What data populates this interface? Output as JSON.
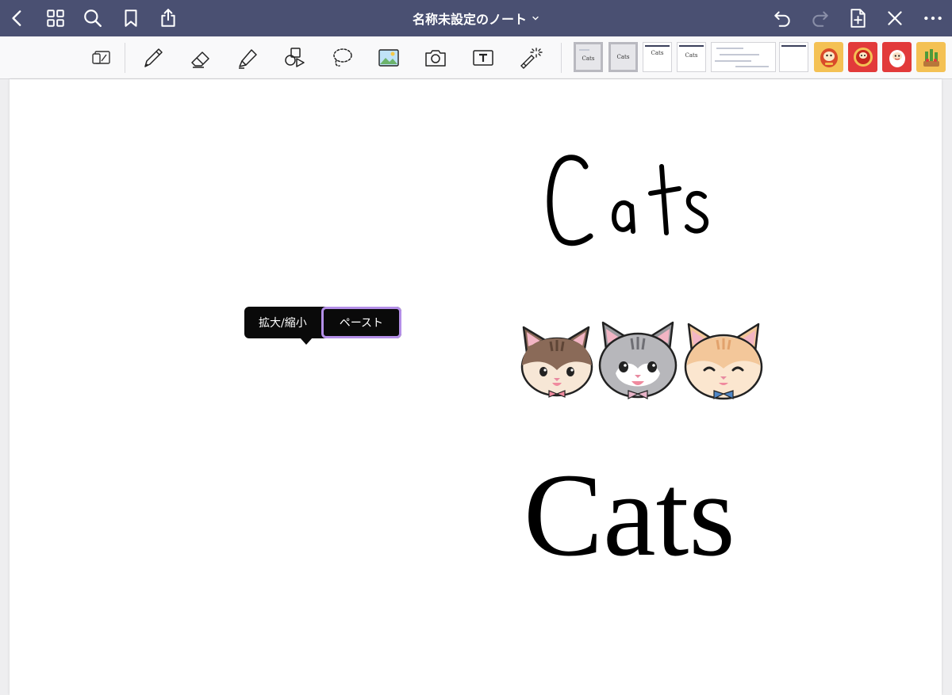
{
  "navbar": {
    "title": "名称未設定のノート",
    "background": "#4a5072",
    "left_icons": [
      "chevron-left-icon",
      "grid-icon",
      "search-icon",
      "bookmark-icon",
      "share-icon"
    ],
    "right_icons": [
      "undo-icon",
      "redo-icon",
      "add-page-icon",
      "close-icon",
      "more-icon"
    ]
  },
  "toolbar": {
    "tools": [
      "read-only-mode-icon",
      "pen-icon",
      "eraser-icon",
      "highlighter-icon",
      "shapes-icon",
      "lasso-icon",
      "image-icon",
      "camera-icon",
      "text-box-icon",
      "laser-pointer-icon"
    ],
    "thumbnails": [
      {
        "label": "Cats",
        "selected": true
      },
      {
        "label": "Cats",
        "selected": true
      },
      {
        "label": "Cats",
        "selected": false
      },
      {
        "label": "Cats",
        "selected": false
      },
      {
        "label": "",
        "selected": false
      },
      {
        "label": "",
        "selected": false
      }
    ],
    "stickers": [
      {
        "name": "daruma-gold-sticker",
        "bg": "#f4c154"
      },
      {
        "name": "daruma-red-sticker",
        "bg": "#e23a3a"
      },
      {
        "name": "daruma-face-sticker",
        "bg": "#e23a3a"
      },
      {
        "name": "kadomatsu-sticker",
        "bg": "#f4c154"
      }
    ]
  },
  "canvas": {
    "handwritten_title": "Cats",
    "serif_title": "Cats",
    "cat_stickers": [
      "brown-tabby-cat",
      "gray-tabby-cat",
      "orange-cat"
    ]
  },
  "popover": {
    "zoom_label": "拡大/縮小",
    "paste_label": "ペースト",
    "focus_color": "#b48fe8"
  }
}
